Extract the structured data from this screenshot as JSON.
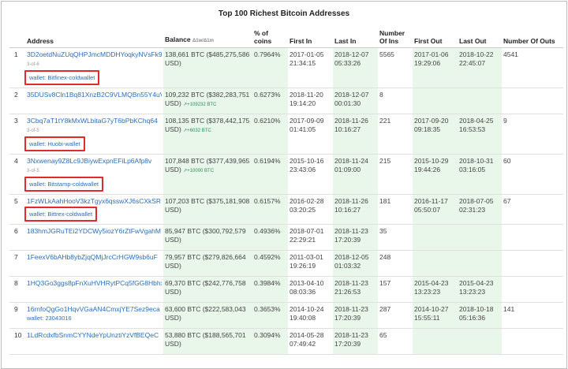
{
  "title": "Top 100 Richest Bitcoin Addresses",
  "headers": {
    "address": "Address",
    "balance": "Balance",
    "balance_delta": "Δ1w/Δ1m",
    "pct": "% of coins",
    "first_in": "First In",
    "last_in": "Last In",
    "num_ins": "Number Of Ins",
    "first_out": "First Out",
    "last_out": "Last Out",
    "num_outs": "Number Of Outs"
  },
  "rows": [
    {
      "rank": "1",
      "address": "3D2oetdNuZUqQHPJmcMDDHYoqkyNVsFk9r",
      "ofn": "3-of-6",
      "wallet": "wallet: Bitfinex-coldwallet",
      "boxed": true,
      "balance": "138,661 BTC ($485,275,586 USD)",
      "delta": "",
      "pct": "0.7964%",
      "first_in_d": "2017-01-05",
      "first_in_t": "21:34:15",
      "last_in_d": "2018-12-07",
      "last_in_t": "05:33:26",
      "ins": "5565",
      "first_out_d": "2017-01-06",
      "first_out_t": "19:29:06",
      "last_out_d": "2018-10-22",
      "last_out_t": "22:45:07",
      "outs": "4541"
    },
    {
      "rank": "2",
      "address": "35DUSv8Cln1Bq81XnzB2C9VLMQBn55Y4uV",
      "ofn": "",
      "wallet": "",
      "boxed": false,
      "balance": "109,232 BTC ($382,283,751 USD)",
      "delta": "↗+109232 BTC",
      "pct": "0.6273%",
      "first_in_d": "2018-11-20",
      "first_in_t": "19:14:20",
      "last_in_d": "2018-12-07",
      "last_in_t": "00:01:30",
      "ins": "8",
      "first_out_d": "",
      "first_out_t": "",
      "last_out_d": "",
      "last_out_t": "",
      "outs": ""
    },
    {
      "rank": "3",
      "address": "3Cbq7aT1tY8kMxWLbitaG7yT6bPbKChq64",
      "ofn": "3-of-5",
      "wallet": "wallet: Huobi-wallet",
      "boxed": true,
      "balance": "108,135 BTC ($378,442,175 USD)",
      "delta": "↗+6032 BTC",
      "pct": "0.6210%",
      "first_in_d": "2017-09-09",
      "first_in_t": "01:41:05",
      "last_in_d": "2018-11-26",
      "last_in_t": "10:16:27",
      "ins": "221",
      "first_out_d": "2017-09-20",
      "first_out_t": "09:18:35",
      "last_out_d": "2018-04-25",
      "last_out_t": "16:53:53",
      "outs": "9"
    },
    {
      "rank": "4",
      "address": "3Nxwenay9Z8Lc9JBiywExpnEFiLp6Afp8v",
      "ofn": "3-of-5",
      "wallet": "wallet: Bitstamp-coldwallet",
      "boxed": true,
      "balance": "107,848 BTC ($377,439,965 USD)",
      "delta": "↗+10000 BTC",
      "pct": "0.6194%",
      "first_in_d": "2015-10-16",
      "first_in_t": "23:43:06",
      "last_in_d": "2018-11-24",
      "last_in_t": "01:09:00",
      "ins": "215",
      "first_out_d": "2015-10-29",
      "first_out_t": "19:44:26",
      "last_out_d": "2018-10-31",
      "last_out_t": "03:16:05",
      "outs": "60"
    },
    {
      "rank": "5",
      "address": "1FzWLkAahHooV3kzTgyx6qsswXJ6sCXkSR",
      "ofn": "",
      "wallet": "wallet: Bittrex-coldwallet",
      "boxed": true,
      "balance": "107,203 BTC ($375,181,908 USD)",
      "delta": "",
      "pct": "0.6157%",
      "first_in_d": "2016-02-28",
      "first_in_t": "03:20:25",
      "last_in_d": "2018-11-26",
      "last_in_t": "10:16:27",
      "ins": "181",
      "first_out_d": "2016-11-17",
      "first_out_t": "05:50:07",
      "last_out_d": "2018-07-05",
      "last_out_t": "02:31:23",
      "outs": "67"
    },
    {
      "rank": "6",
      "address": "183hmJGRuTEi2YDCWy5iozY6rZtFwVgahM",
      "ofn": "",
      "wallet": "",
      "boxed": false,
      "balance": "85,947 BTC ($300,792,579 USD)",
      "delta": "",
      "pct": "0.4936%",
      "first_in_d": "2018-07-01",
      "first_in_t": "22:29:21",
      "last_in_d": "2018-11-23",
      "last_in_t": "17:20:39",
      "ins": "35",
      "first_out_d": "",
      "first_out_t": "",
      "last_out_d": "",
      "last_out_t": "",
      "outs": ""
    },
    {
      "rank": "7",
      "address": "1FeexV6bAHb8ybZjqQMjJrcCrHGW9sb6uF",
      "ofn": "",
      "wallet": "",
      "boxed": false,
      "balance": "79,957 BTC ($279,826,664 USD)",
      "delta": "",
      "pct": "0.4592%",
      "first_in_d": "2011-03-01",
      "first_in_t": "19:26:19",
      "last_in_d": "2018-12-05",
      "last_in_t": "01:03:32",
      "ins": "248",
      "first_out_d": "",
      "first_out_t": "",
      "last_out_d": "",
      "last_out_t": "",
      "outs": ""
    },
    {
      "rank": "8",
      "address": "1HQ3Go3ggs8pFnXuHVHRytPCq5fGG8Hbhx",
      "ofn": "",
      "wallet": "",
      "boxed": false,
      "balance": "69,370 BTC ($242,776,758 USD)",
      "delta": "",
      "pct": "0.3984%",
      "first_in_d": "2013-04-10",
      "first_in_t": "08:03:36",
      "last_in_d": "2018-11-23",
      "last_in_t": "21:26:53",
      "ins": "157",
      "first_out_d": "2015-04-23",
      "first_out_t": "13:23:23",
      "last_out_d": "2015-04-23",
      "last_out_t": "13:23:23",
      "outs": ""
    },
    {
      "rank": "9",
      "address": "16rnfoQgGo1HqvVGaAN4CmxjYE7Sez9eca",
      "ofn": "",
      "wallet": "wallet: 23043016",
      "boxed": false,
      "balance": "63,600 BTC ($222,583,043 USD)",
      "delta": "",
      "pct": "0.3653%",
      "first_in_d": "2014-10-24",
      "first_in_t": "19:40:08",
      "last_in_d": "2018-11-23",
      "last_in_t": "17:20:39",
      "ins": "287",
      "first_out_d": "2014-10-27",
      "first_out_t": "15:55:11",
      "last_out_d": "2018-10-18",
      "last_out_t": "05:16:36",
      "outs": "141"
    },
    {
      "rank": "10",
      "address": "1LdRcdxfbSnmCYYNdeYpUnztiYzVfBEQeC",
      "ofn": "",
      "wallet": "",
      "boxed": false,
      "balance": "53,880 BTC ($188,565,701 USD)",
      "delta": "",
      "pct": "0.3094%",
      "first_in_d": "2014-05-28",
      "first_in_t": "07:49:42",
      "last_in_d": "2018-11-23",
      "last_in_t": "17:20:39",
      "ins": "65",
      "first_out_d": "",
      "first_out_t": "",
      "last_out_d": "",
      "last_out_t": "",
      "outs": ""
    }
  ]
}
